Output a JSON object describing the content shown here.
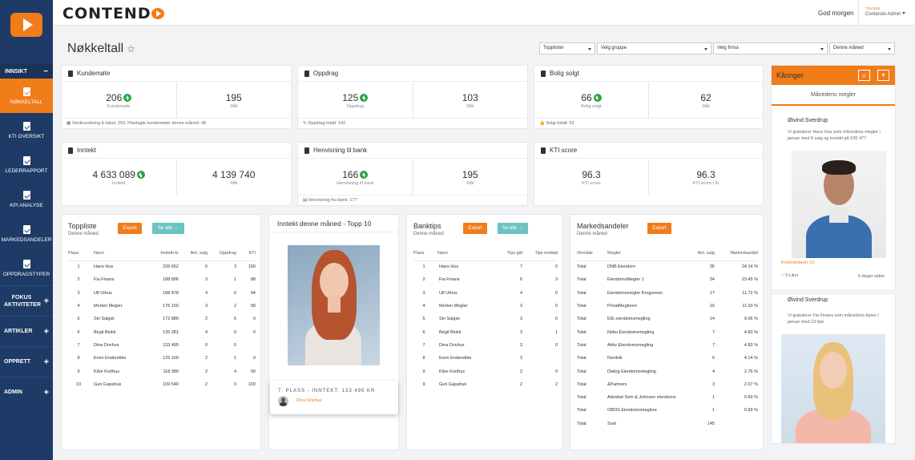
{
  "header": {
    "brand": "CONTEND",
    "greeting": "God morgen",
    "user_small": "TS10005",
    "user_name": "Contendo Admin"
  },
  "sidebar": {
    "section": "INNSIKT",
    "items": [
      {
        "label": "NØKKELTALL",
        "active": true
      },
      {
        "label": "KTI OVERSIKT"
      },
      {
        "label": "LEDERRAPPORT"
      },
      {
        "label": "KPI ANALYSE"
      },
      {
        "label": "MARKEDSANDELER"
      },
      {
        "label": "OPPDRAGSTYPER"
      }
    ],
    "groups": [
      "FOKUS AKTIVITETER",
      "ARTIKLER",
      "OPPRETT",
      "ADMIN"
    ]
  },
  "page": {
    "title": "Nøkkeltall",
    "filters": [
      "Topplister",
      "Velg gruppe",
      "Velg firma",
      "Denne måned"
    ]
  },
  "kpis": [
    {
      "title": "Kundemøte",
      "value": "206",
      "label": "Kundemøte",
      "goal": "195",
      "goal_label": "Mål",
      "foot": "Verdivurdering E-takst: 259. Planlagte kundemøter denne måned: 46"
    },
    {
      "title": "Oppdrag",
      "value": "125",
      "label": "Oppdrag",
      "goal": "103",
      "goal_label": "Mål",
      "foot": "Oppdrag totalt: 142"
    },
    {
      "title": "Bolig solgt",
      "value": "66",
      "label": "Bolig solgt",
      "goal": "62",
      "goal_label": "Mål",
      "foot": "Solgt totalt: 93"
    },
    {
      "title": "Inntekt",
      "value": "4 633 089",
      "label": "Inntekt",
      "goal": "4 139 740",
      "goal_label": "Mål",
      "foot": ""
    },
    {
      "title": "Henvisning til bank",
      "value": "166",
      "label": "Henvisning til bank",
      "goal": "195",
      "goal_label": "Mål",
      "foot": "Henvisning fra bank: 177"
    },
    {
      "title": "KTI score",
      "value": "96.3",
      "label": "KTI score",
      "goal": "96.3",
      "goal_label": "KTI score i år",
      "foot": ""
    }
  ],
  "toppliste": {
    "title": "Toppliste",
    "sub": "Denne måned",
    "export": "Export",
    "see_all": "Se alle →",
    "headers": [
      "Plass",
      "Navn",
      "Inntekt kr",
      "Ant. salg",
      "Oppdrag",
      "KTI"
    ],
    "rows": [
      [
        "1",
        "Hans Hus",
        "226 652",
        "6",
        "3",
        "100"
      ],
      [
        "2",
        "Fia Finans",
        "188 896",
        "3",
        "1",
        "88"
      ],
      [
        "3",
        "Ulf Uthus",
        "188 878",
        "4",
        "0",
        "94"
      ],
      [
        "4",
        "Morten Megler",
        "176 160",
        "3",
        "2",
        "98"
      ],
      [
        "5",
        "Siri Salgsk",
        "172 880",
        "2",
        "6",
        "0"
      ],
      [
        "6",
        "Birgit Blokk",
        "135 281",
        "4",
        "0",
        "0"
      ],
      [
        "7",
        "Dina Drivhus",
        "133 495",
        "0",
        "6",
        ""
      ],
      [
        "8",
        "Even Enderekke",
        "125 100",
        "2",
        "1",
        "0"
      ],
      [
        "9",
        "Kåre Korthus",
        "118 380",
        "2",
        "4",
        "99"
      ],
      [
        "10",
        "Guri Gapahuk",
        "109 540",
        "2",
        "0",
        "100"
      ]
    ]
  },
  "inntekt": {
    "title": "Inntekt denne måned - Topp 10",
    "place": "7. PLASS - INNTEKT: 133 495 KR",
    "name": "Dina Drivhus"
  },
  "banktips": {
    "title": "Banktips",
    "sub": "Denne måned",
    "export": "Export",
    "see_all": "Se alle →",
    "headers": [
      "Plass",
      "Navn",
      "Tips gitt",
      "Tips mottatt"
    ],
    "rows": [
      [
        "1",
        "Hans Hus",
        "7",
        "0"
      ],
      [
        "2",
        "Fia Finans",
        "6",
        "3"
      ],
      [
        "3",
        "Ulf Uthus",
        "4",
        "0"
      ],
      [
        "4",
        "Morten Megler",
        "3",
        "0"
      ],
      [
        "5",
        "Siri Salgsk",
        "3",
        "0"
      ],
      [
        "6",
        "Birgit Blokk",
        "3",
        "1"
      ],
      [
        "7",
        "Dina Drivhus",
        "3",
        "0"
      ],
      [
        "8",
        "Even Enderekke",
        "3",
        ""
      ],
      [
        "9",
        "Kåre Korthus",
        "2",
        "0"
      ],
      [
        "9",
        "Guri Gapahuk",
        "2",
        "2"
      ]
    ]
  },
  "markedsandeler": {
    "title": "Markedsandeler",
    "sub": "Denne måned",
    "export": "Export",
    "headers": [
      "Område",
      "Megler",
      "Ant. salg",
      "Markedsandel"
    ],
    "rows": [
      [
        "Total",
        "DNB Eiendom",
        "35",
        "24.14 %"
      ],
      [
        "Total",
        "EiendomsMegler 1",
        "34",
        "23.45 %"
      ],
      [
        "Total",
        "Eiendomsmegler Krogsveen",
        "17",
        "11.72 %"
      ],
      [
        "Total",
        "PrivatMegleren",
        "16",
        "11.03 %"
      ],
      [
        "Total",
        "EIE eiendomsmegling",
        "14",
        "9.66 %"
      ],
      [
        "Total",
        "Nobo Eiendomsmegling",
        "7",
        "4.83 %"
      ],
      [
        "Total",
        "Aktiv Eiendomsmegling",
        "7",
        "4.83 %"
      ],
      [
        "Total",
        "Nordvik",
        "6",
        "4.14 %"
      ],
      [
        "Total",
        "Dialog Eiendomsmegling",
        "4",
        "2.76 %"
      ],
      [
        "Total",
        "&Partners",
        "3",
        "2.07 %"
      ],
      [
        "Total",
        "Advokat Sem & Johnsen eiendoms",
        "1",
        "0.69 %"
      ],
      [
        "Total",
        "OBOS Eiendomsmeglere",
        "1",
        "0.69 %"
      ],
      [
        "Total",
        "Sum",
        "145",
        ""
      ]
    ]
  },
  "karinger": {
    "title": "Kåringer",
    "tab": "Månedens megler",
    "entries": [
      {
        "name": "Øivind Sverdrup",
        "text": "Vi gratulerer Hans Hus som månedens megler i januar med 8 salg og inntekt på 536 477",
        "comment": "Kommentarer (1)",
        "likes": "3 Liker",
        "age": "6 dager siden"
      },
      {
        "name": "Øivind Sverdrup",
        "text": "Vi gratulerer Fia Finans som månedens tipser i januar med 23 tips"
      }
    ]
  }
}
